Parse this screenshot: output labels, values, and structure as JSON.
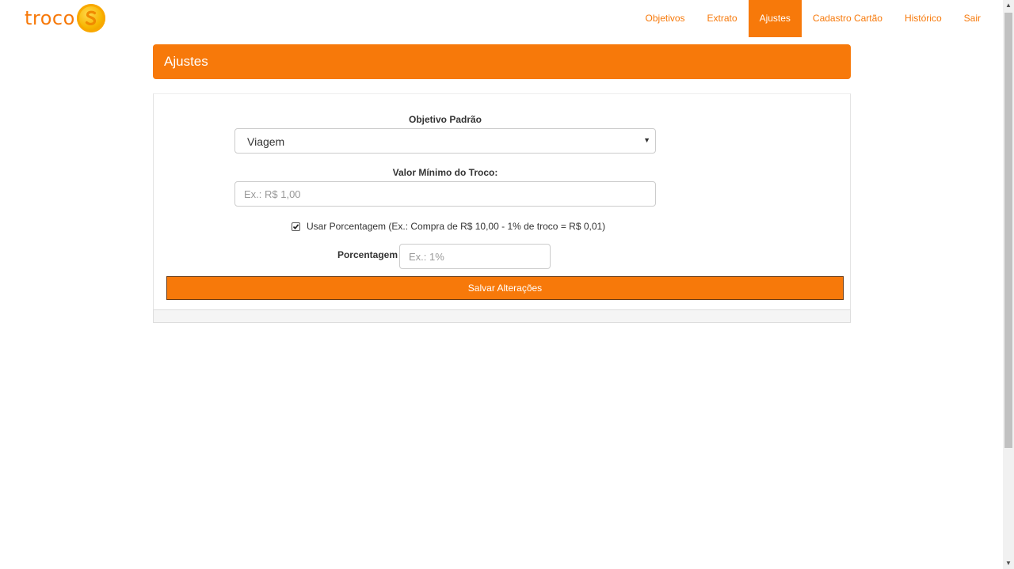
{
  "brand": {
    "name": "troco",
    "logo_icon": "coin-s-icon",
    "color": "#f7790a"
  },
  "nav": {
    "items": [
      {
        "label": "Objetivos",
        "active": false
      },
      {
        "label": "Extrato",
        "active": false
      },
      {
        "label": "Ajustes",
        "active": true
      },
      {
        "label": "Cadastro Cartão",
        "active": false
      },
      {
        "label": "Histórico",
        "active": false
      },
      {
        "label": "Sair",
        "active": false
      }
    ]
  },
  "panel": {
    "title": "Ajustes"
  },
  "form": {
    "objetivo_label": "Objetivo Padrão",
    "objetivo_value": "Viagem",
    "valor_label": "Valor Mínimo do Troco:",
    "valor_placeholder": "Ex.: R$ 1,00",
    "valor_value": "",
    "checkbox_label": "Usar Porcentagem (Ex.: Compra de R$ 10,00 - 1% de troco = R$ 0,01)",
    "checkbox_checked": true,
    "porcentagem_label": "Porcentagem",
    "porcentagem_placeholder": "Ex.: 1%",
    "porcentagem_value": "",
    "save_label": "Salvar Alterações"
  },
  "colors": {
    "accent": "#f7790a",
    "button_border": "#6b3a12"
  }
}
